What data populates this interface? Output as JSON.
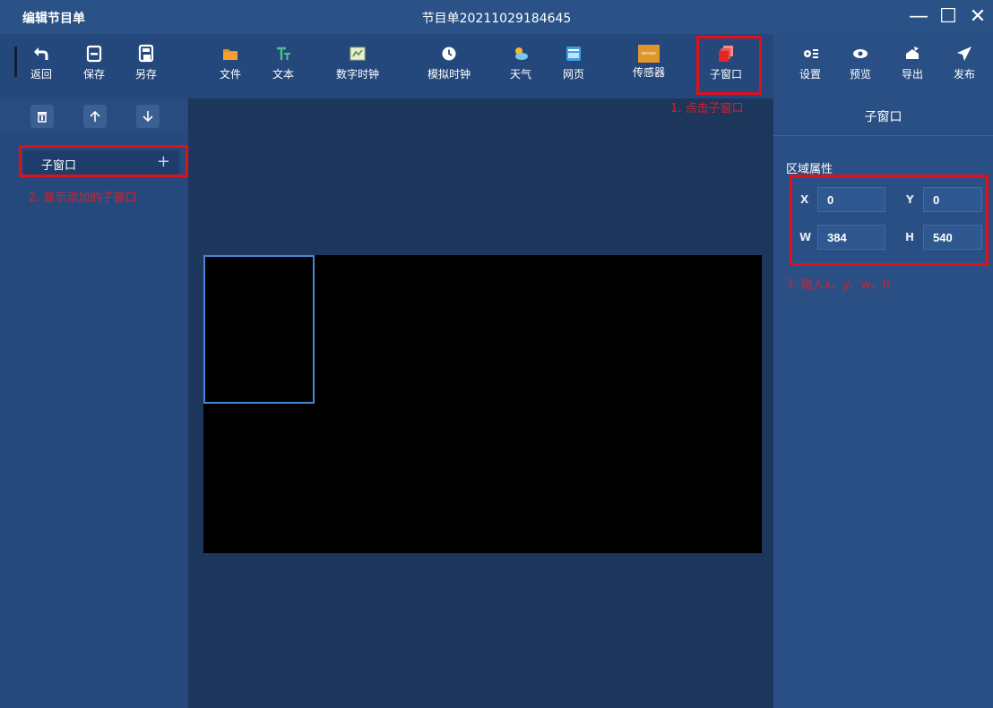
{
  "window": {
    "app_title": "编辑节目单",
    "doc_title": "节目单20211029184645",
    "minimize_glyph": "—",
    "maximize_glyph": "☐",
    "close_glyph": "✕"
  },
  "toolbar": {
    "left": [
      {
        "label": "返回",
        "icon": "back-icon"
      },
      {
        "label": "保存",
        "icon": "save-icon"
      },
      {
        "label": "另存",
        "icon": "save-as-icon"
      }
    ],
    "center": [
      {
        "label": "文件",
        "icon": "folder-icon"
      },
      {
        "label": "文本",
        "icon": "text-icon"
      },
      {
        "label": "数字时钟",
        "icon": "digital-clock-icon"
      },
      {
        "label": "模拟时钟",
        "icon": "analog-clock-icon"
      },
      {
        "label": "天气",
        "icon": "weather-icon"
      },
      {
        "label": "网页",
        "icon": "webpage-icon"
      },
      {
        "label": "传感器",
        "icon": "sensor-icon"
      },
      {
        "label": "子窗口",
        "icon": "subwindow-icon"
      }
    ],
    "right": [
      {
        "label": "设置",
        "icon": "settings-icon"
      },
      {
        "label": "预览",
        "icon": "preview-icon"
      },
      {
        "label": "导出",
        "icon": "export-icon"
      },
      {
        "label": "发布",
        "icon": "publish-icon"
      }
    ],
    "sensor_icon_text": "sensor"
  },
  "left_panel": {
    "items": [
      {
        "label": "子窗口",
        "plus": "+"
      }
    ]
  },
  "right_panel": {
    "title": "子窗口",
    "section_title": "区域属性",
    "props": {
      "x": {
        "label": "X",
        "value": "0"
      },
      "y": {
        "label": "Y",
        "value": "0"
      },
      "w": {
        "label": "W",
        "value": "384"
      },
      "h": {
        "label": "H",
        "value": "540"
      }
    }
  },
  "annotations": {
    "step1": "1. 点击子窗口",
    "step2": "2. 显示添加的子窗口",
    "step3": "3. 输入x、y、w、h"
  },
  "colors": {
    "titlebar": "#2b5287",
    "toolbar": "#25487c",
    "panel": "#2a4f84",
    "canvas_bg": "#1d365c",
    "screen": "#000000",
    "subwindow_border": "#4a86d6",
    "annotation_red": "#e0101a"
  }
}
